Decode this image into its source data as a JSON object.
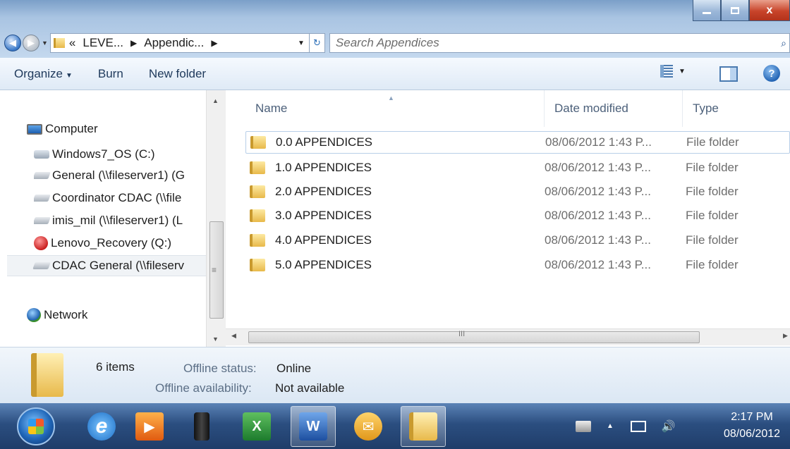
{
  "window": {
    "address": {
      "overflow": "«",
      "crumbs": [
        "LEVE...",
        "Appendic..."
      ],
      "refresh_icon": "refresh-icon"
    },
    "search": {
      "placeholder": "Search Appendices"
    },
    "buttons": {
      "close_label": "x"
    }
  },
  "toolbar": {
    "organize": "Organize",
    "burn": "Burn",
    "new_folder": "New folder",
    "help": "?"
  },
  "nav_pane": {
    "computer": "Computer",
    "drives": [
      {
        "label": "Windows7_OS (C:)",
        "icon": "disk-icon"
      },
      {
        "label": "General (\\\\fileserver1) (G",
        "icon": "network-drive-icon"
      },
      {
        "label": "Coordinator CDAC (\\\\file",
        "icon": "network-drive-icon"
      },
      {
        "label": "imis_mil (\\\\fileserver1) (L",
        "icon": "network-drive-icon"
      },
      {
        "label": "Lenovo_Recovery (Q:)",
        "icon": "recovery-icon"
      },
      {
        "label": "CDAC General (\\\\fileserv",
        "icon": "network-drive-icon",
        "selected": true
      }
    ],
    "network": "Network"
  },
  "file_list": {
    "columns": {
      "name": "Name",
      "date": "Date modified",
      "type": "Type"
    },
    "rows": [
      {
        "name": "0.0 APPENDICES",
        "date": "08/06/2012 1:43 P...",
        "type": "File folder"
      },
      {
        "name": "1.0 APPENDICES",
        "date": "08/06/2012 1:43 P...",
        "type": "File folder"
      },
      {
        "name": "2.0 APPENDICES",
        "date": "08/06/2012 1:43 P...",
        "type": "File folder"
      },
      {
        "name": "3.0 APPENDICES",
        "date": "08/06/2012 1:43 P...",
        "type": "File folder"
      },
      {
        "name": "4.0 APPENDICES",
        "date": "08/06/2012 1:43 P...",
        "type": "File folder"
      },
      {
        "name": "5.0 APPENDICES",
        "date": "08/06/2012 1:43 P...",
        "type": "File folder"
      }
    ]
  },
  "details": {
    "count": "6 items",
    "offline_status_label": "Offline status:",
    "offline_status_value": "Online",
    "offline_avail_label": "Offline availability:",
    "offline_avail_value": "Not available"
  },
  "taskbar": {
    "apps": [
      "internet-explorer-icon",
      "media-player-icon",
      "server-tower-icon",
      "excel-icon",
      "word-icon",
      "outlook-icon",
      "windows-explorer-icon"
    ],
    "time": "2:17 PM",
    "date": "08/06/2012"
  }
}
